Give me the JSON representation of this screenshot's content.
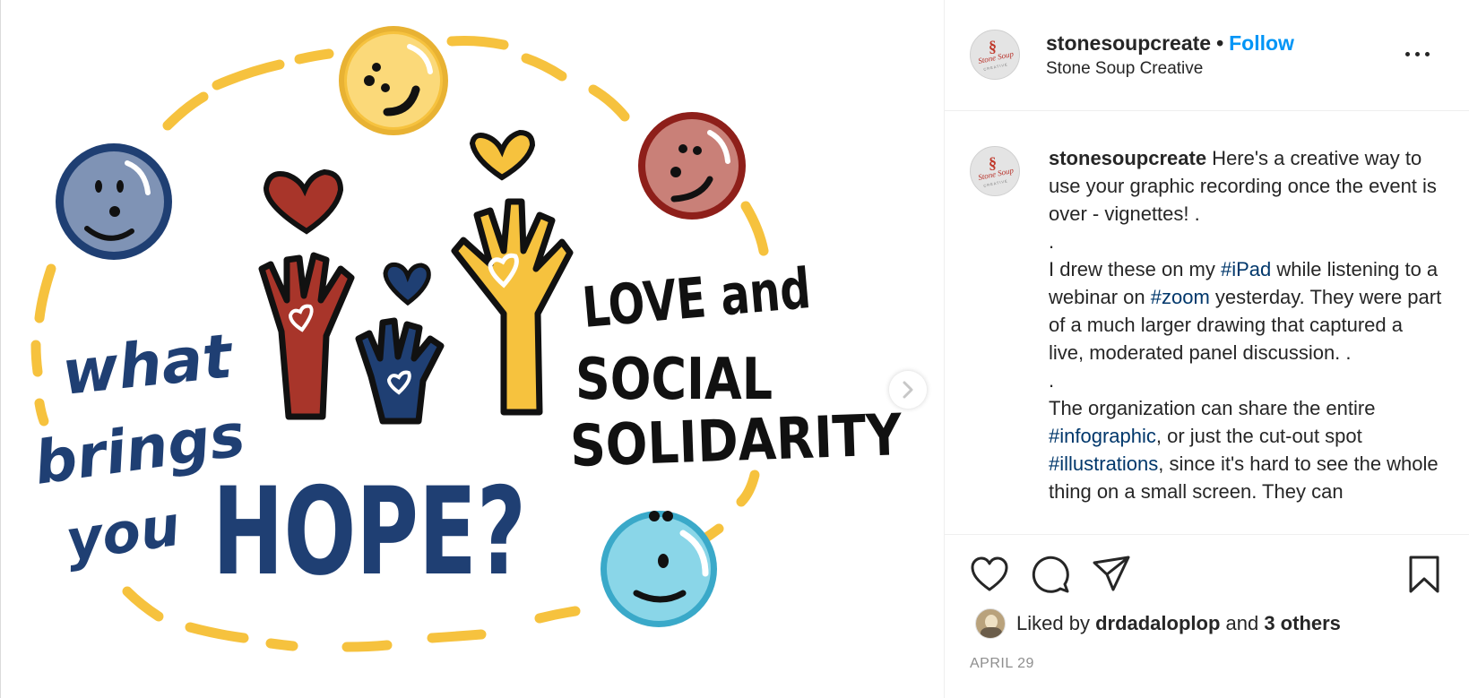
{
  "media": {
    "artwork_text": {
      "question_line1": "what",
      "question_line2": "brings",
      "question_line3": "you",
      "question_big": "HOPE?",
      "answer_line1": "LOVE and",
      "answer_line2": "SOCIAL",
      "answer_line3": "SOLIDARITY"
    },
    "colors": {
      "navy": "#1f3f73",
      "yellow": "#f6c23e",
      "dark_red": "#a8352a",
      "light_blue": "#6fcbe0",
      "grey_blue": "#7f93b5",
      "pink": "#c98078",
      "black": "#111111"
    }
  },
  "header": {
    "username": "stonesoupcreate",
    "separator": "•",
    "follow_label": "Follow",
    "subtitle": "Stone Soup Creative",
    "avatar_logo": "Stone Soup",
    "avatar_sub": "CREATIVE"
  },
  "caption": {
    "username": "stonesoupcreate",
    "intro": " Here's a creative way to use your graphic recording once the event is over - vignettes! .",
    "dot1": ".",
    "p2_a": "I drew these on my ",
    "tag_ipad": "#iPad",
    "p2_b": " while listening to a webinar on ",
    "tag_zoom": "#zoom",
    "p2_c": " yesterday. They were part of a much larger drawing that captured a live, moderated panel discussion. .",
    "dot2": ".",
    "p3_a": "The organization can share the entire ",
    "tag_infographic": "#infographic",
    "p3_b": ", or just the cut-out spot ",
    "tag_illustrations": "#illustrations",
    "p3_c": ", since it's hard to see the whole thing on a small screen. They can"
  },
  "actions": {
    "icons": [
      "heart-icon",
      "comment-icon",
      "share-icon",
      "bookmark-icon"
    ],
    "liked_prefix": "Liked by ",
    "liked_user": "drdadaloplop",
    "liked_and": " and ",
    "liked_others": "3 others",
    "date": "APRIL 29"
  }
}
